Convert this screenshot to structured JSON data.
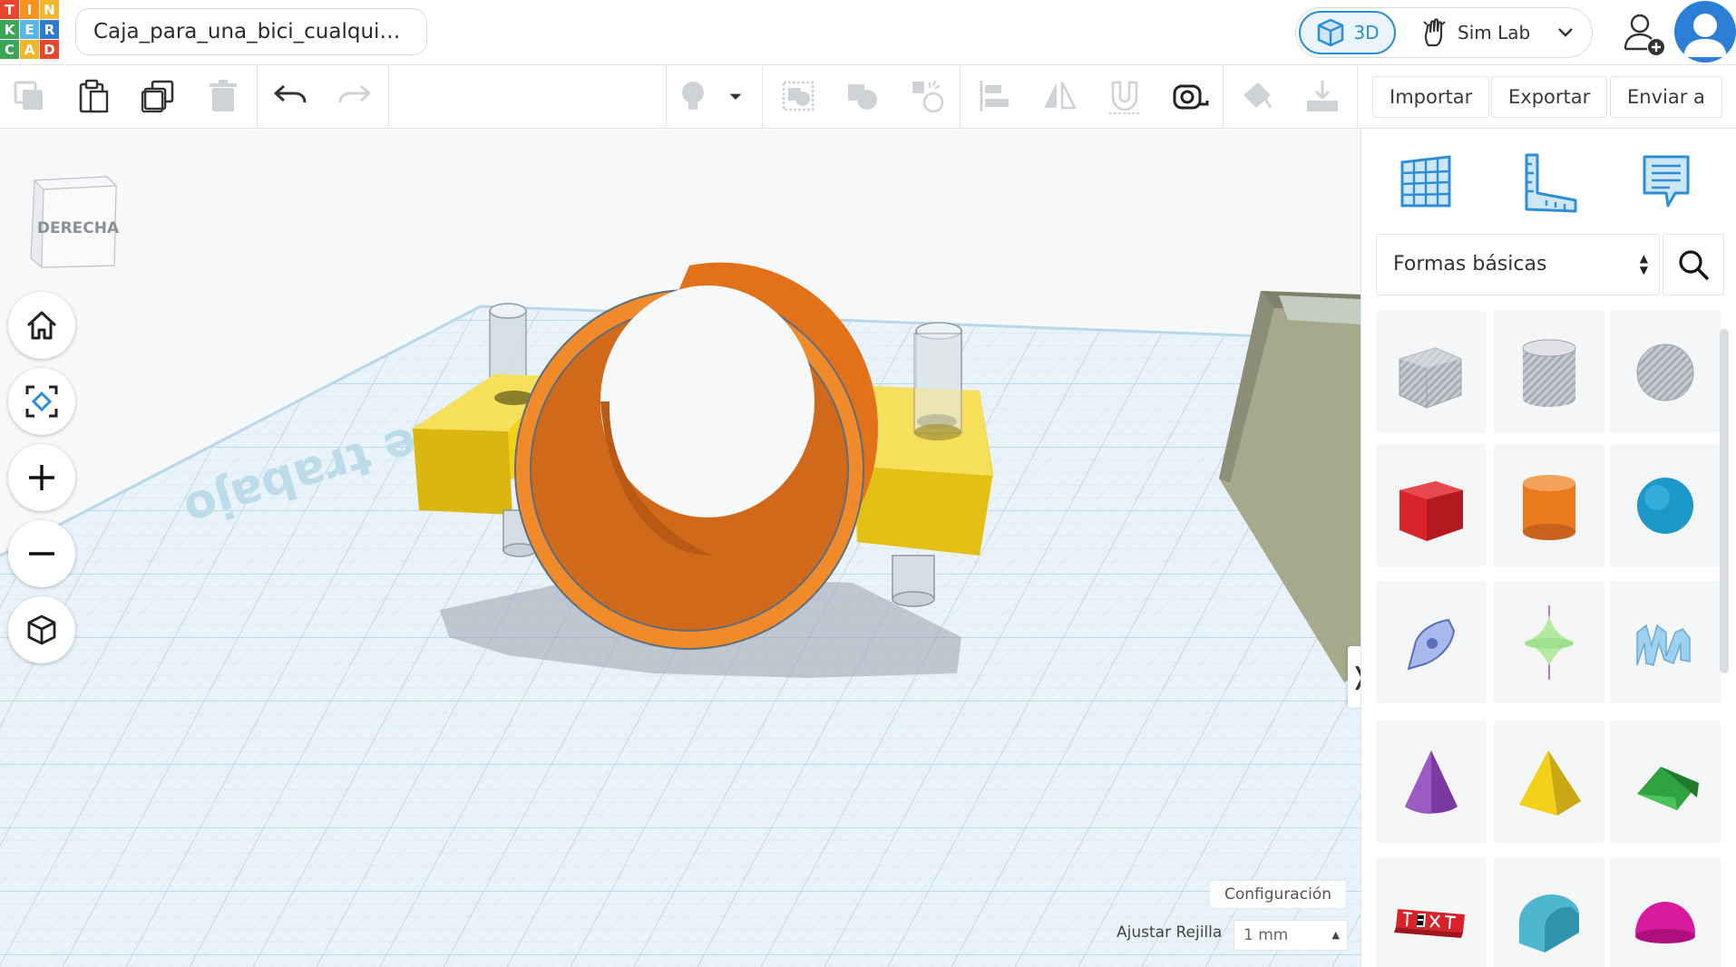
{
  "app": {
    "logo_letters": [
      "T",
      "I",
      "N",
      "K",
      "E",
      "R",
      "C",
      "A",
      "D"
    ],
    "logo_colors": [
      "#e8452c",
      "#f7931e",
      "#f3b52a",
      "#3aa655",
      "#56b9e5",
      "#2f7bd1",
      "#3aa655",
      "#f3b52a",
      "#e8452c"
    ]
  },
  "header": {
    "document_title": "Caja_para_una_bici_cualqui…",
    "mode_3d_label": "3D",
    "mode_simlab_label": "Sim Lab"
  },
  "toolbar": {
    "import_label": "Importar",
    "export_label": "Exportar",
    "send_label": "Enviar a",
    "icons": [
      "copy-icon",
      "paste-icon",
      "duplicate-icon",
      "delete-icon",
      "undo-icon",
      "redo-icon",
      "light-bulb-icon",
      "dropdown-icon",
      "group-icon",
      "ungroup-icon",
      "cruise-icon",
      "align-icon",
      "mirror-icon",
      "magnet-icon",
      "ruler-tape-icon",
      "paint-icon",
      "export-down-icon"
    ]
  },
  "viewport": {
    "view_cube_label": "DERECHA",
    "workplane_text": "Plano de trabajo",
    "settings_label": "Configuración",
    "grid_label": "Ajustar Rejilla",
    "grid_value": "1 mm",
    "colors": {
      "orange": "#e97a1e",
      "yellow": "#f3d01a",
      "olive": "#a7a98c",
      "grid": "#c6e2f0"
    }
  },
  "panel": {
    "shape_category": "Formas básicas",
    "shapes": [
      {
        "name": "box-hole",
        "color": "#b9bcc3"
      },
      {
        "name": "cylinder-hole",
        "color": "#b9bcc3"
      },
      {
        "name": "sphere-hole",
        "color": "#b9bcc3"
      },
      {
        "name": "box",
        "color": "#d8232a"
      },
      {
        "name": "cylinder",
        "color": "#e97a1e"
      },
      {
        "name": "sphere",
        "color": "#1b97c8"
      },
      {
        "name": "scribble",
        "color": "#7f9be0"
      },
      {
        "name": "shape-generator",
        "color": "#9fe08e"
      },
      {
        "name": "text-wave",
        "color": "#8fc3e6"
      },
      {
        "name": "cone",
        "color": "#7b3aa2"
      },
      {
        "name": "pyramid",
        "color": "#f3d01a"
      },
      {
        "name": "roof",
        "color": "#2fa33f"
      },
      {
        "name": "text",
        "color": "#d8232a"
      },
      {
        "name": "half-cylinder",
        "color": "#4fb6cf"
      },
      {
        "name": "half-sphere",
        "color": "#d9199c"
      }
    ]
  }
}
